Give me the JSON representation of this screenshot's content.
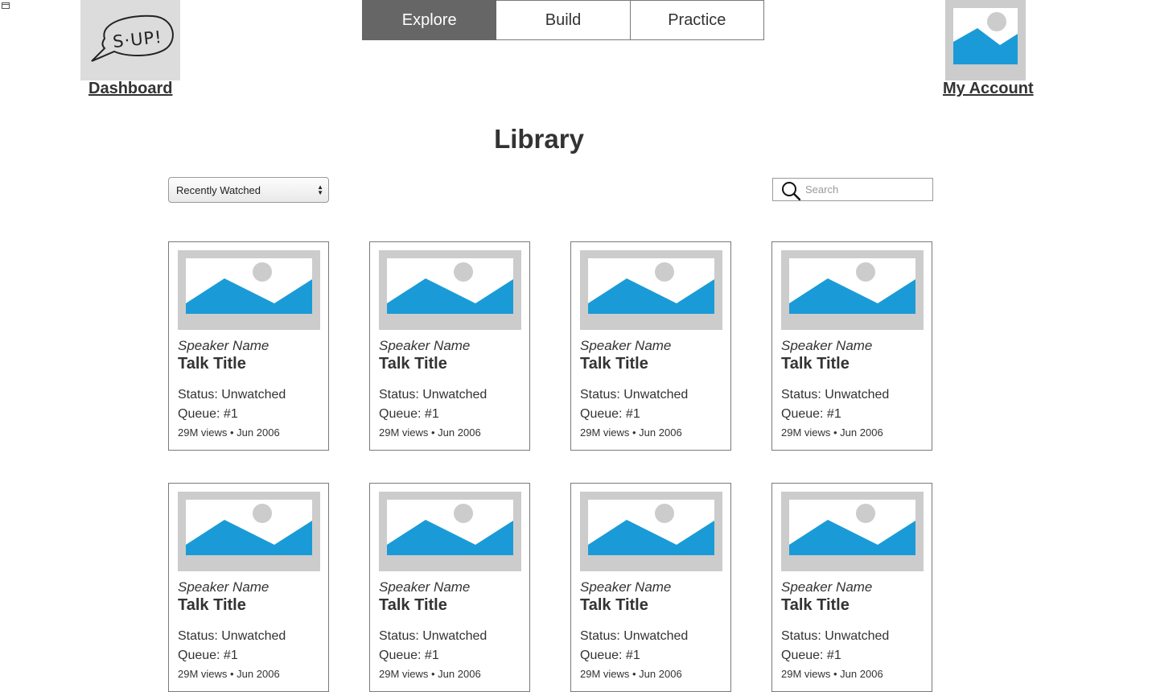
{
  "header": {
    "logo_text": "S·UP!",
    "dashboard_label": "Dashboard",
    "account_label": "My Account",
    "tabs": [
      {
        "label": "Explore",
        "active": true
      },
      {
        "label": "Build",
        "active": false
      },
      {
        "label": "Practice",
        "active": false
      }
    ]
  },
  "main": {
    "title": "Library",
    "sort": {
      "selected": "Recently Watched"
    },
    "search": {
      "placeholder": "Search",
      "value": ""
    },
    "cards": [
      {
        "speaker": "Speaker Name",
        "title": "Talk Title",
        "status": "Status: Unwatched",
        "queue": "Queue: #1",
        "meta": "29M views • Jun 2006"
      },
      {
        "speaker": "Speaker Name",
        "title": "Talk Title",
        "status": "Status: Unwatched",
        "queue": "Queue: #1",
        "meta": "29M views • Jun 2006"
      },
      {
        "speaker": "Speaker Name",
        "title": "Talk Title",
        "status": "Status: Unwatched",
        "queue": "Queue: #1",
        "meta": "29M views • Jun 2006"
      },
      {
        "speaker": "Speaker Name",
        "title": "Talk Title",
        "status": "Status: Unwatched",
        "queue": "Queue: #1",
        "meta": "29M views • Jun 2006"
      },
      {
        "speaker": "Speaker Name",
        "title": "Talk Title",
        "status": "Status: Unwatched",
        "queue": "Queue: #1",
        "meta": "29M views • Jun 2006"
      },
      {
        "speaker": "Speaker Name",
        "title": "Talk Title",
        "status": "Status: Unwatched",
        "queue": "Queue: #1",
        "meta": "29M views • Jun 2006"
      },
      {
        "speaker": "Speaker Name",
        "title": "Talk Title",
        "status": "Status: Unwatched",
        "queue": "Queue: #1",
        "meta": "29M views • Jun 2006"
      },
      {
        "speaker": "Speaker Name",
        "title": "Talk Title",
        "status": "Status: Unwatched",
        "queue": "Queue: #1",
        "meta": "29M views • Jun 2006"
      }
    ]
  },
  "colors": {
    "active_tab": "#666666",
    "placeholder_bg": "#cccccc",
    "placeholder_accent": "#1a9bd7"
  }
}
